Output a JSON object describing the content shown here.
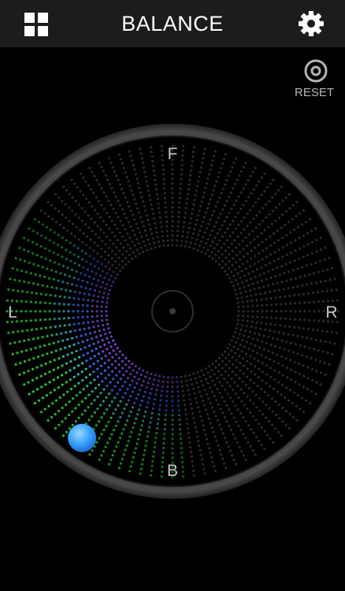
{
  "header": {
    "title": "BALANCE",
    "menu_icon": "grid-icon",
    "settings_icon": "gear-icon"
  },
  "reset": {
    "label": "RESET",
    "icon": "target-reset-icon"
  },
  "dial": {
    "labels": {
      "front": "F",
      "back": "B",
      "left": "L",
      "right": "R"
    },
    "handle_color": "#3aa6ff",
    "balance_left_right": -0.82,
    "balance_front_back": -0.78
  },
  "colors": {
    "background": "#000000",
    "header_bg": "#1c1c1c",
    "title": "#ffffff",
    "label": "#c8c8c8",
    "dot_idle": "#3a3a3a",
    "accent_green": "#22cc33",
    "accent_teal": "#22bbaa",
    "accent_blue": "#3366ee",
    "accent_purple": "#7744cc"
  }
}
